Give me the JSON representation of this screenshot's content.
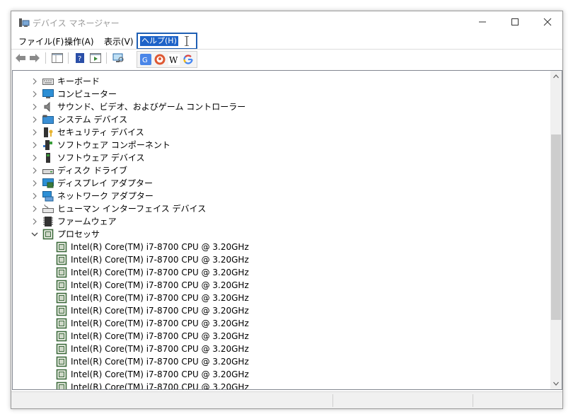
{
  "window": {
    "title": "デバイス マネージャー"
  },
  "menu": {
    "file": "ファイル(F)",
    "action": "操作(A)",
    "view": "表示(V)",
    "help": "ヘルプ(H)"
  },
  "extensions": [
    "google-translate-icon",
    "duckduckgo-icon",
    "wikipedia-icon",
    "google-icon"
  ],
  "tree": {
    "categories": [
      {
        "label": "キーボード",
        "icon": "keyboard-icon"
      },
      {
        "label": "コンピューター",
        "icon": "monitor-icon"
      },
      {
        "label": "サウンド、ビデオ、およびゲーム コントローラー",
        "icon": "speaker-icon"
      },
      {
        "label": "システム デバイス",
        "icon": "system-folder-icon"
      },
      {
        "label": "セキュリティ デバイス",
        "icon": "security-device-icon"
      },
      {
        "label": "ソフトウェア コンポーネント",
        "icon": "software-component-icon"
      },
      {
        "label": "ソフトウェア デバイス",
        "icon": "software-device-icon"
      },
      {
        "label": "ディスク ドライブ",
        "icon": "disk-drive-icon"
      },
      {
        "label": "ディスプレイ アダプター",
        "icon": "display-adapter-icon"
      },
      {
        "label": "ネットワーク アダプター",
        "icon": "network-adapter-icon"
      },
      {
        "label": "ヒューマン インターフェイス デバイス",
        "icon": "hid-icon"
      },
      {
        "label": "ファームウェア",
        "icon": "firmware-icon"
      },
      {
        "label": "プロセッサ",
        "icon": "processor-icon",
        "expanded": true
      }
    ],
    "processors": [
      "Intel(R) Core(TM) i7-8700 CPU @ 3.20GHz",
      "Intel(R) Core(TM) i7-8700 CPU @ 3.20GHz",
      "Intel(R) Core(TM) i7-8700 CPU @ 3.20GHz",
      "Intel(R) Core(TM) i7-8700 CPU @ 3.20GHz",
      "Intel(R) Core(TM) i7-8700 CPU @ 3.20GHz",
      "Intel(R) Core(TM) i7-8700 CPU @ 3.20GHz",
      "Intel(R) Core(TM) i7-8700 CPU @ 3.20GHz",
      "Intel(R) Core(TM) i7-8700 CPU @ 3.20GHz",
      "Intel(R) Core(TM) i7-8700 CPU @ 3.20GHz",
      "Intel(R) Core(TM) i7-8700 CPU @ 3.20GHz",
      "Intel(R) Core(TM) i7-8700 CPU @ 3.20GHz",
      "Intel(R) Core(TM) i7-8700 CPU @ 3.20GHz"
    ]
  },
  "colors": {
    "accent": "#1e63c8",
    "chip": "#3d6b3d"
  }
}
